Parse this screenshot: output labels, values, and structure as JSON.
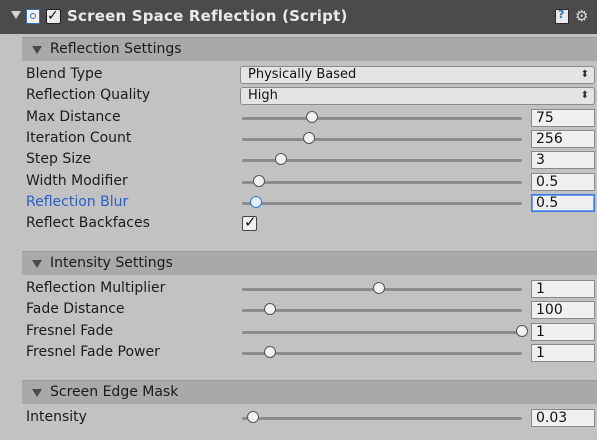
{
  "header": {
    "title": "Screen Space Reflection (Script)",
    "enabled": true,
    "icons": [
      "foldout-arrow-icon",
      "script-icon",
      "help-book-icon",
      "gear-icon"
    ]
  },
  "sections": [
    {
      "label": "Reflection Settings",
      "rows": [
        {
          "label": "Blend Type",
          "type": "dropdown",
          "value": "Physically Based"
        },
        {
          "label": "Reflection Quality",
          "type": "dropdown",
          "value": "High"
        },
        {
          "label": "Max Distance",
          "type": "slider",
          "value": "75",
          "slider_fraction": 0.25
        },
        {
          "label": "Iteration Count",
          "type": "slider",
          "value": "256",
          "slider_fraction": 0.24
        },
        {
          "label": "Step Size",
          "type": "slider",
          "value": "3",
          "slider_fraction": 0.14
        },
        {
          "label": "Width Modifier",
          "type": "slider",
          "value": "0.5",
          "slider_fraction": 0.06
        },
        {
          "label": "Reflection Blur",
          "type": "slider",
          "value": "0.5",
          "slider_fraction": 0.05,
          "focused": true
        },
        {
          "label": "Reflect Backfaces",
          "type": "checkbox",
          "checked": true
        }
      ]
    },
    {
      "label": "Intensity Settings",
      "rows": [
        {
          "label": "Reflection Multiplier",
          "type": "slider",
          "value": "1",
          "slider_fraction": 0.49
        },
        {
          "label": "Fade Distance",
          "type": "slider",
          "value": "100",
          "slider_fraction": 0.1
        },
        {
          "label": "Fresnel Fade",
          "type": "slider",
          "value": "1",
          "slider_fraction": 1.0
        },
        {
          "label": "Fresnel Fade Power",
          "type": "slider",
          "value": "1",
          "slider_fraction": 0.1
        }
      ]
    },
    {
      "label": "Screen Edge Mask",
      "rows": [
        {
          "label": "Intensity",
          "type": "slider",
          "value": "0.03",
          "slider_fraction": 0.04
        }
      ]
    }
  ],
  "colors": {
    "panel_bg": "#c2c2c2",
    "header_bg": "#4b4b4b",
    "section_bg": "#a9a9a9",
    "focus_accent": "#2c5ec5"
  }
}
